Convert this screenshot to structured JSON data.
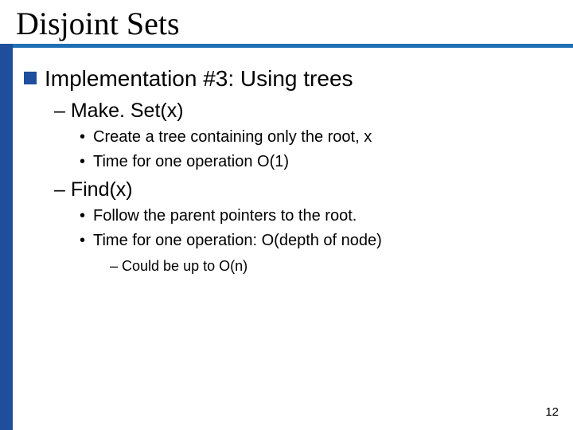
{
  "title": "Disjoint Sets",
  "lvl1": "Implementation #3: Using trees",
  "sec1": {
    "heading": "– Make. Set(x)",
    "b1": "Create a tree containing only the root, x",
    "b2": "Time for one operation O(1)"
  },
  "sec2": {
    "heading": "– Find(x)",
    "b1": "Follow the parent pointers to the root.",
    "b2": "Time for one operation: O(depth of node)",
    "sub": "– Could be up to O(n)"
  },
  "page": "12"
}
